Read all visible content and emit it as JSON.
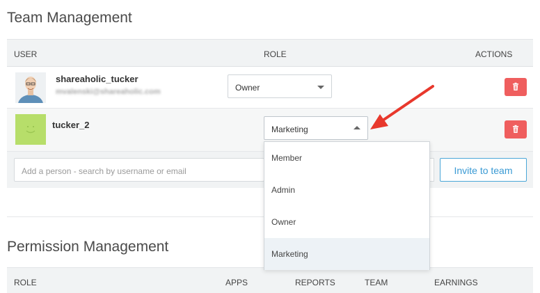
{
  "team": {
    "title": "Team Management",
    "columns": {
      "user": "USER",
      "role": "ROLE",
      "actions": "ACTIONS"
    },
    "members": [
      {
        "username": "shareaholic_tucker",
        "email": "mvalenski@shareaholic.com",
        "role": "Owner",
        "dropdown_open": false
      },
      {
        "username": "tucker_2",
        "email": "",
        "role": "Marketing",
        "dropdown_open": true
      }
    ],
    "invite": {
      "placeholder": "Add a person - search by username or email",
      "button": "Invite to team"
    }
  },
  "role_dropdown": {
    "options": [
      "Member",
      "Admin",
      "Owner",
      "Marketing"
    ],
    "selected": "Marketing"
  },
  "permissions": {
    "title": "Permission Management",
    "columns": {
      "role": "ROLE",
      "apps": "APPS",
      "reports": "REPORTS",
      "team": "TEAM",
      "earnings": "EARNINGS"
    }
  },
  "colors": {
    "delete_button": "#ef5e5e",
    "invite_border": "#4aa7d8",
    "annotation_arrow": "#e8382c",
    "placeholder_avatar": "#b7de6a"
  },
  "icons": {
    "delete": "trash-icon",
    "select_closed": "caret-down-icon",
    "select_open": "caret-up-icon",
    "annotation": "red-arrow"
  }
}
